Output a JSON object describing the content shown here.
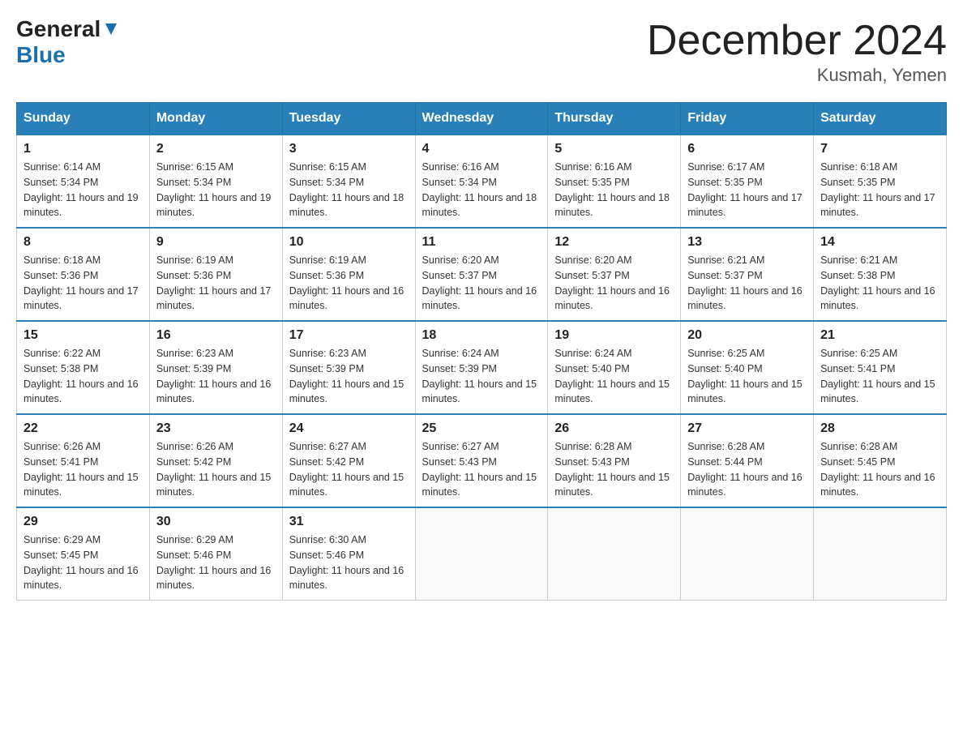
{
  "logo": {
    "general": "General",
    "blue": "Blue",
    "arrow": "▼"
  },
  "title": "December 2024",
  "subtitle": "Kusmah, Yemen",
  "days": [
    "Sunday",
    "Monday",
    "Tuesday",
    "Wednesday",
    "Thursday",
    "Friday",
    "Saturday"
  ],
  "weeks": [
    [
      {
        "day": "1",
        "sunrise": "6:14 AM",
        "sunset": "5:34 PM",
        "daylight": "11 hours and 19 minutes."
      },
      {
        "day": "2",
        "sunrise": "6:15 AM",
        "sunset": "5:34 PM",
        "daylight": "11 hours and 19 minutes."
      },
      {
        "day": "3",
        "sunrise": "6:15 AM",
        "sunset": "5:34 PM",
        "daylight": "11 hours and 18 minutes."
      },
      {
        "day": "4",
        "sunrise": "6:16 AM",
        "sunset": "5:34 PM",
        "daylight": "11 hours and 18 minutes."
      },
      {
        "day": "5",
        "sunrise": "6:16 AM",
        "sunset": "5:35 PM",
        "daylight": "11 hours and 18 minutes."
      },
      {
        "day": "6",
        "sunrise": "6:17 AM",
        "sunset": "5:35 PM",
        "daylight": "11 hours and 17 minutes."
      },
      {
        "day": "7",
        "sunrise": "6:18 AM",
        "sunset": "5:35 PM",
        "daylight": "11 hours and 17 minutes."
      }
    ],
    [
      {
        "day": "8",
        "sunrise": "6:18 AM",
        "sunset": "5:36 PM",
        "daylight": "11 hours and 17 minutes."
      },
      {
        "day": "9",
        "sunrise": "6:19 AM",
        "sunset": "5:36 PM",
        "daylight": "11 hours and 17 minutes."
      },
      {
        "day": "10",
        "sunrise": "6:19 AM",
        "sunset": "5:36 PM",
        "daylight": "11 hours and 16 minutes."
      },
      {
        "day": "11",
        "sunrise": "6:20 AM",
        "sunset": "5:37 PM",
        "daylight": "11 hours and 16 minutes."
      },
      {
        "day": "12",
        "sunrise": "6:20 AM",
        "sunset": "5:37 PM",
        "daylight": "11 hours and 16 minutes."
      },
      {
        "day": "13",
        "sunrise": "6:21 AM",
        "sunset": "5:37 PM",
        "daylight": "11 hours and 16 minutes."
      },
      {
        "day": "14",
        "sunrise": "6:21 AM",
        "sunset": "5:38 PM",
        "daylight": "11 hours and 16 minutes."
      }
    ],
    [
      {
        "day": "15",
        "sunrise": "6:22 AM",
        "sunset": "5:38 PM",
        "daylight": "11 hours and 16 minutes."
      },
      {
        "day": "16",
        "sunrise": "6:23 AM",
        "sunset": "5:39 PM",
        "daylight": "11 hours and 16 minutes."
      },
      {
        "day": "17",
        "sunrise": "6:23 AM",
        "sunset": "5:39 PM",
        "daylight": "11 hours and 15 minutes."
      },
      {
        "day": "18",
        "sunrise": "6:24 AM",
        "sunset": "5:39 PM",
        "daylight": "11 hours and 15 minutes."
      },
      {
        "day": "19",
        "sunrise": "6:24 AM",
        "sunset": "5:40 PM",
        "daylight": "11 hours and 15 minutes."
      },
      {
        "day": "20",
        "sunrise": "6:25 AM",
        "sunset": "5:40 PM",
        "daylight": "11 hours and 15 minutes."
      },
      {
        "day": "21",
        "sunrise": "6:25 AM",
        "sunset": "5:41 PM",
        "daylight": "11 hours and 15 minutes."
      }
    ],
    [
      {
        "day": "22",
        "sunrise": "6:26 AM",
        "sunset": "5:41 PM",
        "daylight": "11 hours and 15 minutes."
      },
      {
        "day": "23",
        "sunrise": "6:26 AM",
        "sunset": "5:42 PM",
        "daylight": "11 hours and 15 minutes."
      },
      {
        "day": "24",
        "sunrise": "6:27 AM",
        "sunset": "5:42 PM",
        "daylight": "11 hours and 15 minutes."
      },
      {
        "day": "25",
        "sunrise": "6:27 AM",
        "sunset": "5:43 PM",
        "daylight": "11 hours and 15 minutes."
      },
      {
        "day": "26",
        "sunrise": "6:28 AM",
        "sunset": "5:43 PM",
        "daylight": "11 hours and 15 minutes."
      },
      {
        "day": "27",
        "sunrise": "6:28 AM",
        "sunset": "5:44 PM",
        "daylight": "11 hours and 16 minutes."
      },
      {
        "day": "28",
        "sunrise": "6:28 AM",
        "sunset": "5:45 PM",
        "daylight": "11 hours and 16 minutes."
      }
    ],
    [
      {
        "day": "29",
        "sunrise": "6:29 AM",
        "sunset": "5:45 PM",
        "daylight": "11 hours and 16 minutes."
      },
      {
        "day": "30",
        "sunrise": "6:29 AM",
        "sunset": "5:46 PM",
        "daylight": "11 hours and 16 minutes."
      },
      {
        "day": "31",
        "sunrise": "6:30 AM",
        "sunset": "5:46 PM",
        "daylight": "11 hours and 16 minutes."
      },
      null,
      null,
      null,
      null
    ]
  ],
  "labels": {
    "sunrise": "Sunrise:",
    "sunset": "Sunset:",
    "daylight": "Daylight:"
  }
}
